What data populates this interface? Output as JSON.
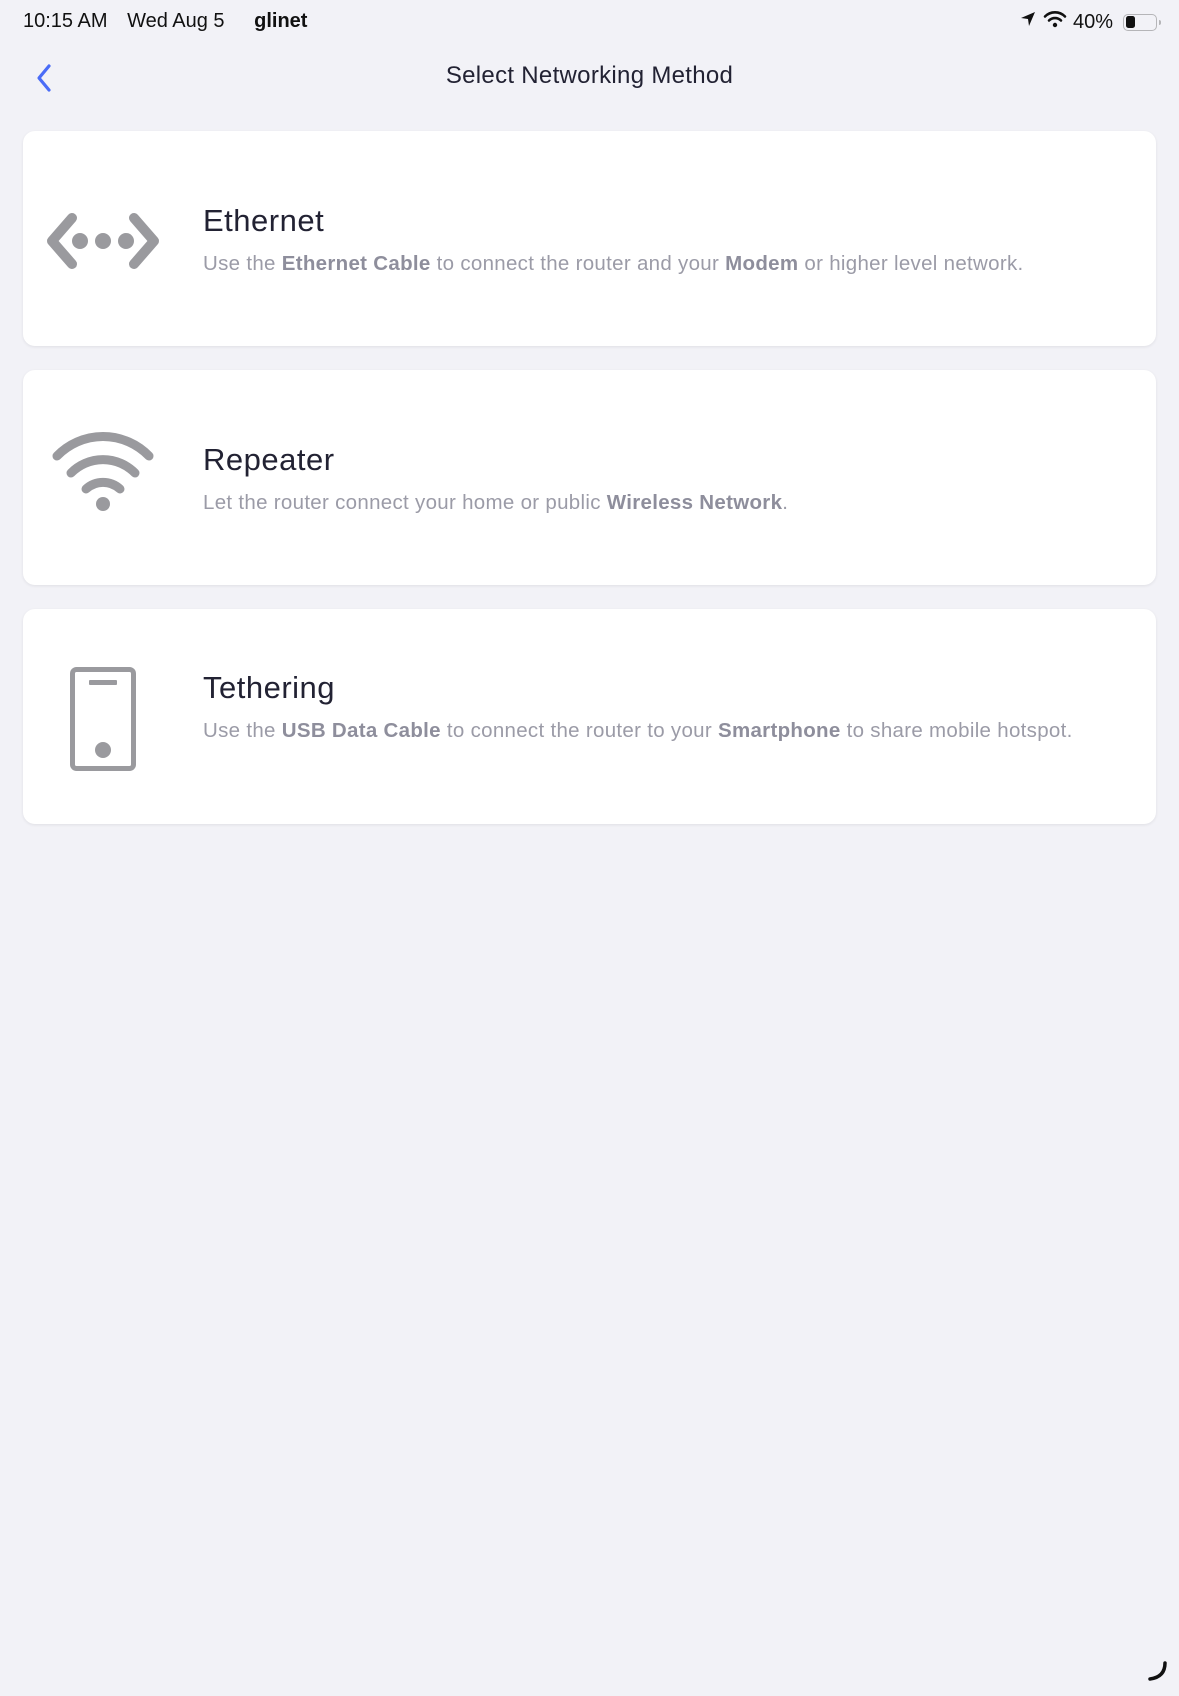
{
  "status_bar": {
    "time": "10:15 AM",
    "date": "Wed Aug 5",
    "app": "glinet",
    "battery_text": "40%",
    "battery_level": 0.4
  },
  "nav": {
    "back_icon": "chevron-left-icon",
    "title": "Select Networking Method",
    "accent_color": "#4a6cf7"
  },
  "options": [
    {
      "icon": "ethernet-icon",
      "title": "Ethernet",
      "desc_parts": [
        {
          "text": "Use the ",
          "bold": false
        },
        {
          "text": "Ethernet Cable",
          "bold": true
        },
        {
          "text": " to connect the router and your ",
          "bold": false
        },
        {
          "text": "Modem",
          "bold": true
        },
        {
          "text": " or higher level network.",
          "bold": false
        }
      ]
    },
    {
      "icon": "wifi-icon",
      "title": "Repeater",
      "desc_parts": [
        {
          "text": "Let the router connect your home or public ",
          "bold": false
        },
        {
          "text": "Wireless Network",
          "bold": true
        },
        {
          "text": ".",
          "bold": false
        }
      ]
    },
    {
      "icon": "smartphone-icon",
      "title": "Tethering",
      "desc_parts": [
        {
          "text": "Use the ",
          "bold": false
        },
        {
          "text": "USB Data Cable",
          "bold": true
        },
        {
          "text": " to connect the router to your ",
          "bold": false
        },
        {
          "text": "Smartphone",
          "bold": true
        },
        {
          "text": " to share mobile hotspot.",
          "bold": false
        }
      ]
    }
  ],
  "colors": {
    "background": "#f2f2f7",
    "card": "#ffffff",
    "icon_gray": "#9a9a9e",
    "title_text": "#222233",
    "desc_text": "#9b9ba7"
  }
}
